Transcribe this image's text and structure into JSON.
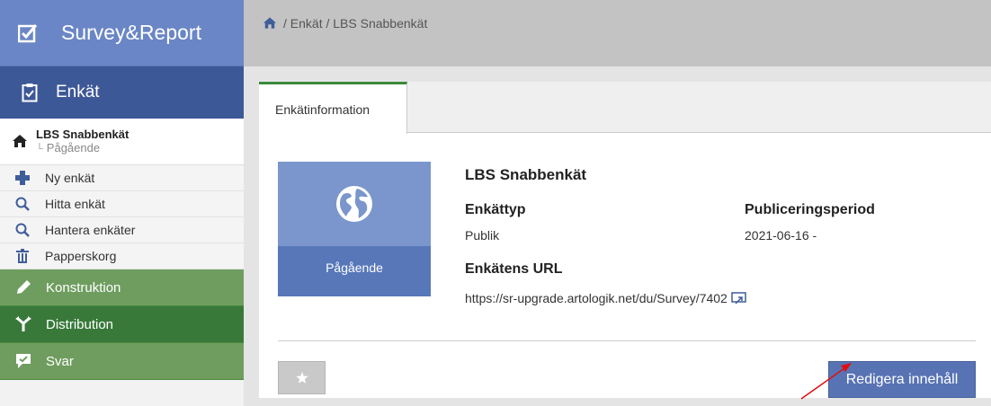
{
  "brand": {
    "name": "Survey&Report"
  },
  "sidebar": {
    "section_title": "Enkät",
    "current": {
      "title": "LBS Snabbenkät",
      "status_prefix": "└",
      "status": "Pågående"
    },
    "items": [
      {
        "label": "Ny enkät",
        "icon": "plus-icon"
      },
      {
        "label": "Hitta enkät",
        "icon": "search-icon"
      },
      {
        "label": "Hantera enkäter",
        "icon": "search-icon"
      },
      {
        "label": "Papperskorg",
        "icon": "trash-icon"
      }
    ],
    "groups": [
      {
        "label": "Konstruktion",
        "icon": "pencil-icon"
      },
      {
        "label": "Distribution",
        "icon": "distribution-icon"
      },
      {
        "label": "Svar",
        "icon": "comment-icon"
      }
    ]
  },
  "breadcrumb": {
    "text": " / Enkät / LBS Snabbenkät"
  },
  "tabs": [
    {
      "label": "Enkätinformation",
      "active": true
    }
  ],
  "survey": {
    "tile_status": "Pågående",
    "title": "LBS Snabbenkät",
    "type_label": "Enkättyp",
    "type_value": "Publik",
    "period_label": "Publiceringsperiod",
    "period_value": "2021-06-16 -",
    "url_label": "Enkätens URL",
    "url_value": "https://sr-upgrade.artologik.net/du/Survey/7402"
  },
  "buttons": {
    "edit": "Redigera innehåll"
  },
  "colors": {
    "brand": "#6a86c6",
    "section": "#3d5896",
    "green_light": "#6f9d5f",
    "green_dark": "#38793a",
    "primary_button": "#5873b4",
    "annotation_arrow": "#e01010"
  }
}
